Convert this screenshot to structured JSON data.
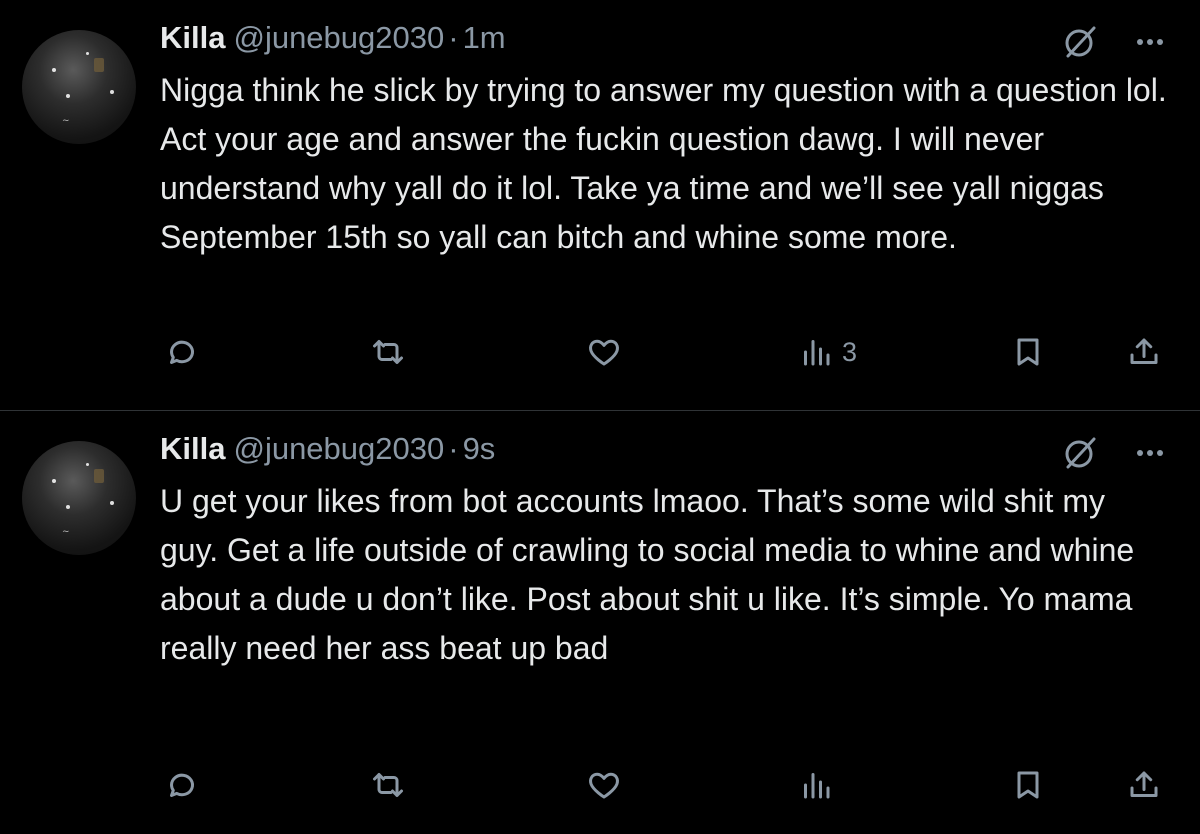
{
  "tweets": [
    {
      "name": "Killa",
      "handle": "@junebug2030",
      "separator": "·",
      "time": "1m",
      "text": "Nigga think he slick by trying to answer my question with a question lol. Act your age and answer the fuckin question dawg. I will never understand why yall do it lol. Take ya time and we’ll see yall niggas September 15th so yall can bitch and whine some more.",
      "views": "3"
    },
    {
      "name": "Killa",
      "handle": "@junebug2030",
      "separator": "·",
      "time": "9s",
      "text": "U get your likes from bot accounts lmaoo. That’s some wild shit my guy. Get a life outside of crawling to social media to whine and whine about a dude u don’t like. Post about shit u like. It’s simple. Yo mama really need her ass beat up bad",
      "views": ""
    }
  ],
  "icons": {
    "reply": "reply-icon",
    "repost": "repost-icon",
    "like": "heart-icon",
    "views": "views-icon",
    "bookmark": "bookmark-icon",
    "share": "share-icon",
    "grok": "grok-icon",
    "more": "more-icon"
  },
  "colors": {
    "background": "#000000",
    "text": "#e7e9ea",
    "secondary": "#8b98a5",
    "divider": "#2f3336"
  }
}
